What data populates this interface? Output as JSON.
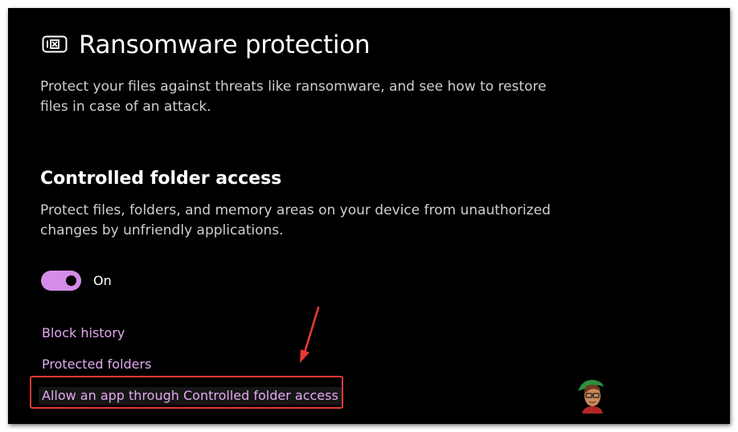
{
  "header": {
    "icon": "ransomware-shield-icon",
    "title": "Ransomware protection",
    "description": "Protect your files against threats like ransomware, and see how to restore files in case of an attack."
  },
  "section": {
    "title": "Controlled folder access",
    "description": "Protect files, folders, and memory areas on your device from unauthorized changes by unfriendly applications."
  },
  "toggle": {
    "state": "on",
    "label": "On",
    "accent_color": "#d58be8"
  },
  "links": {
    "block_history": "Block history",
    "protected_folders": "Protected folders",
    "allow_app": "Allow an app through Controlled folder access"
  },
  "annotation": {
    "highlight_color": "#e53935",
    "arrow": "red-arrow-icon"
  },
  "colors": {
    "background": "#000000",
    "link": "#e3a9f2",
    "text": "#ffffff",
    "secondary_text": "#cfcfcf"
  }
}
